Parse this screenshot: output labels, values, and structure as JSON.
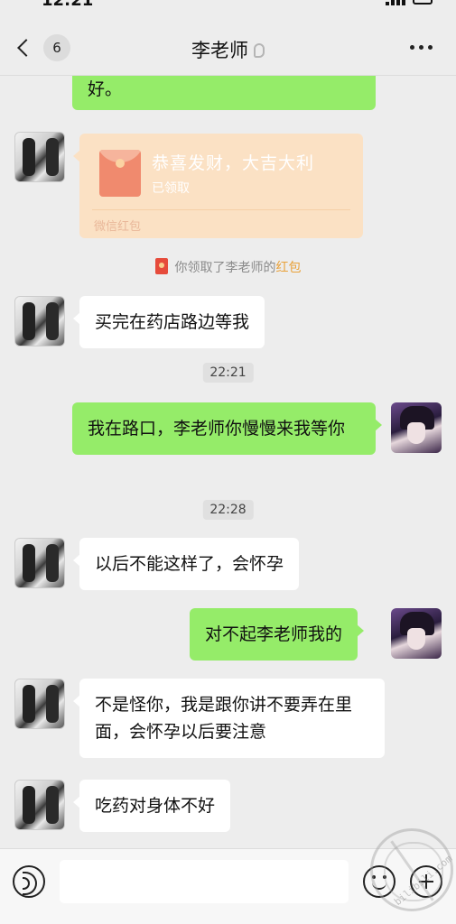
{
  "status_bar": {
    "time": "12:21"
  },
  "header": {
    "unread_count": "6",
    "title": "李老师"
  },
  "messages": {
    "m0": "好。",
    "red_packet": {
      "title": "恭喜发财，大吉大利",
      "status": "已领取",
      "footer": "微信红包"
    },
    "notice": {
      "prefix": "你领取了李老师的",
      "link": "红包"
    },
    "m1": "买完在药店路边等我",
    "t1": "22:21",
    "m2": "我在路口，李老师你慢慢来我等你",
    "t2": "22:28",
    "m3": "以后不能这样了，会怀孕",
    "m4": "对不起李老师我的",
    "m5": "不是怪你，我是跟你讲不要弄在里面，会怀孕以后要注意",
    "m6": "吃药对身体不好"
  },
  "input_bar": {
    "placeholder": ""
  },
  "watermark": {
    "text": "bilibili.com"
  },
  "colors": {
    "background": "#ededed",
    "bubble_self": "#95ec69",
    "bubble_other": "#ffffff",
    "red_packet": "#fbe1c4",
    "notice_link": "#e9a23b"
  }
}
